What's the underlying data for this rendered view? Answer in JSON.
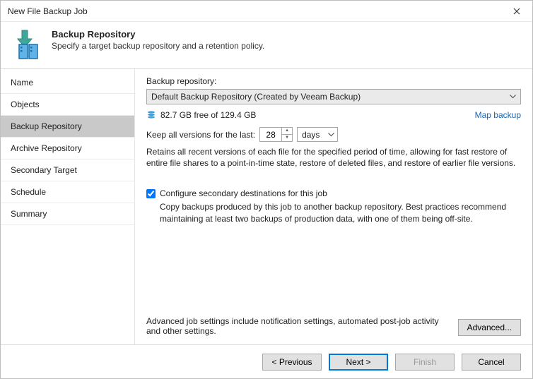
{
  "window": {
    "title": "New File Backup Job"
  },
  "header": {
    "title": "Backup Repository",
    "subtitle": "Specify a target backup repository and a retention policy."
  },
  "sidebar": {
    "items": [
      {
        "label": "Name"
      },
      {
        "label": "Objects"
      },
      {
        "label": "Backup Repository",
        "selected": true
      },
      {
        "label": "Archive Repository"
      },
      {
        "label": "Secondary Target"
      },
      {
        "label": "Schedule"
      },
      {
        "label": "Summary"
      }
    ]
  },
  "main": {
    "repo_label": "Backup repository:",
    "repo_value": "Default Backup Repository (Created by Veeam Backup)",
    "storage_text": "82.7 GB free of 129.4 GB",
    "map_backup": "Map backup",
    "keep_label": "Keep all versions for the last:",
    "keep_value": "28",
    "keep_unit": "days",
    "retain_desc": "Retains all recent versions of each file for the specified period of time, allowing for fast restore of entire file shares to a point-in-time state, restore of deleted files, and restore of earlier file versions.",
    "secondary_check": "Configure secondary destinations for this job",
    "secondary_desc": "Copy backups produced by this job to another backup repository. Best practices recommend maintaining at least two backups of production data, with one of them being off-site.",
    "advanced_text": "Advanced job settings include notification settings, automated post-job activity and other settings.",
    "advanced_btn": "Advanced..."
  },
  "footer": {
    "previous": "< Previous",
    "next": "Next >",
    "finish": "Finish",
    "cancel": "Cancel"
  }
}
